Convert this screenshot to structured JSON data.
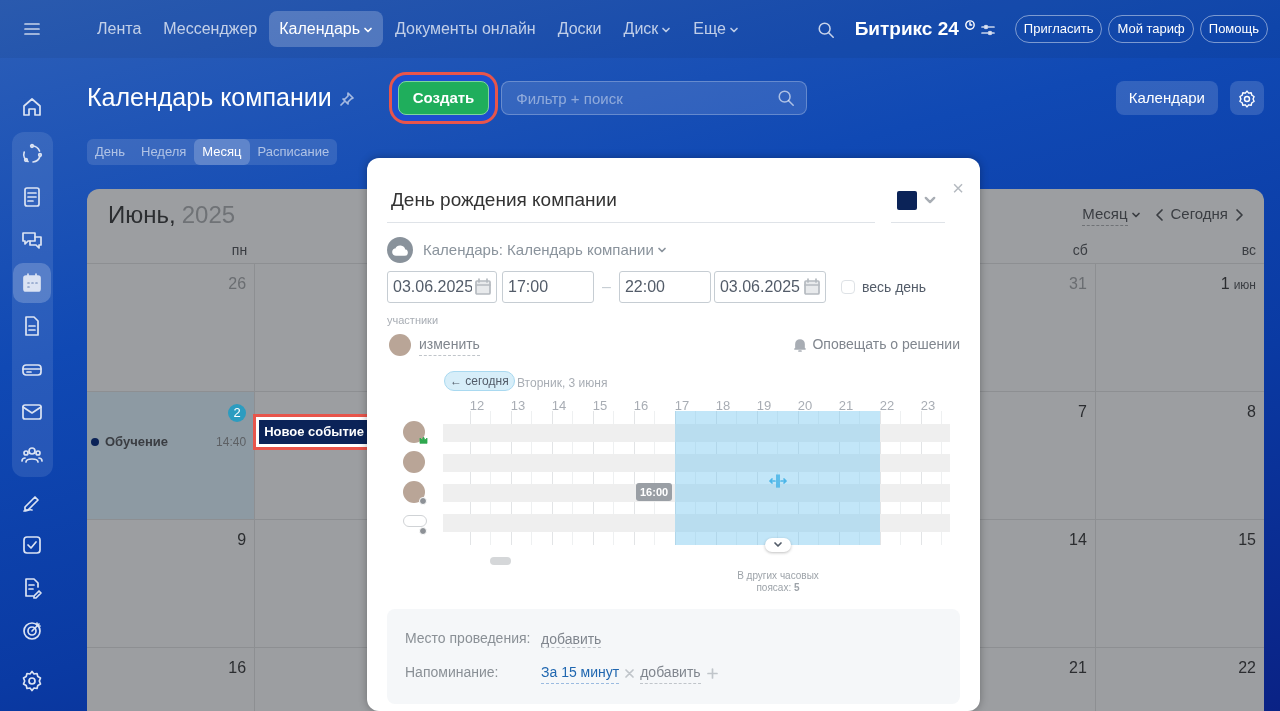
{
  "nav": {
    "items": [
      {
        "label": "Лента",
        "selected": false,
        "dropdown": false
      },
      {
        "label": "Мессенджер",
        "selected": false,
        "dropdown": false
      },
      {
        "label": "Календарь",
        "selected": true,
        "dropdown": true
      },
      {
        "label": "Документы онлайн",
        "selected": false,
        "dropdown": false
      },
      {
        "label": "Доски",
        "selected": false,
        "dropdown": false
      },
      {
        "label": "Диск",
        "selected": false,
        "dropdown": true
      },
      {
        "label": "Еще",
        "selected": false,
        "dropdown": true
      }
    ],
    "logo": "Битрикс 24",
    "buttons": [
      "Пригласить",
      "Мой тариф",
      "Помощь"
    ]
  },
  "sidebar": {
    "groups": [
      {
        "boxed": false,
        "items": [
          {
            "kind": "home",
            "selected": false
          }
        ]
      },
      {
        "boxed": true,
        "items": [
          {
            "kind": "chart",
            "selected": false
          },
          {
            "kind": "feed",
            "selected": false
          },
          {
            "kind": "chat",
            "selected": false
          },
          {
            "kind": "calendar",
            "selected": true
          },
          {
            "kind": "doc",
            "selected": false
          },
          {
            "kind": "drive",
            "selected": false
          },
          {
            "kind": "mail",
            "selected": false
          },
          {
            "kind": "people",
            "selected": false
          }
        ]
      },
      {
        "boxed": false,
        "items": [
          {
            "kind": "pencil",
            "selected": false
          },
          {
            "kind": "check",
            "selected": false
          },
          {
            "kind": "doc-edit",
            "selected": false
          },
          {
            "kind": "target",
            "selected": false
          }
        ]
      }
    ],
    "settings": {
      "kind": "gear",
      "selected": false
    }
  },
  "header": {
    "title": "Календарь компании",
    "create_button": {
      "label": "Создать",
      "highlighted": true
    },
    "search": {
      "placeholder": "Фильтр + поиск"
    },
    "calendars_button": "Календари"
  },
  "view_tabs": [
    {
      "label": "День",
      "selected": false
    },
    {
      "label": "Неделя",
      "selected": false
    },
    {
      "label": "Месяц",
      "selected": true
    },
    {
      "label": "Расписание",
      "selected": false
    }
  ],
  "calendar": {
    "month": "Июнь,",
    "year": "2025",
    "view": "Месяц",
    "today_button": "Сегодня",
    "weekdays": {
      "mon": "пн",
      "sat": "сб",
      "sun": "вс"
    },
    "weeks": [
      {
        "mon": {
          "day": "26",
          "other_month": true,
          "today": false
        },
        "sat": {
          "day": "31",
          "other_month": true,
          "today": false
        },
        "sun": {
          "day": "1",
          "month": "июн",
          "other_month": false,
          "today": false
        }
      },
      {
        "mon": {
          "day": "2",
          "other_month": false,
          "today": true,
          "events": [
            {
              "title": "Обучение",
              "time": "14:40",
              "color": "#0b2358"
            }
          ]
        },
        "tue": {
          "events": [
            {
              "title": "Новое событие",
              "kind": "draft",
              "highlighted": true
            }
          ]
        },
        "sat": {
          "day": "7",
          "other_month": false,
          "today": false
        },
        "sun": {
          "day": "8",
          "other_month": false,
          "today": false
        }
      },
      {
        "mon": {
          "day": "9",
          "other_month": false,
          "today": false
        },
        "sat": {
          "day": "14",
          "other_month": false,
          "today": false
        },
        "sun": {
          "day": "15",
          "other_month": false,
          "today": false
        }
      },
      {
        "mon": {
          "day": "16",
          "other_month": false,
          "today": false
        },
        "sat": {
          "day": "21",
          "other_month": false,
          "today": false
        },
        "sun": {
          "day": "22",
          "other_month": false,
          "today": false
        }
      }
    ]
  },
  "event_popup": {
    "title": "День рождения компании",
    "close": "×",
    "color": "#0b2358",
    "calendar": "Календарь: Календарь компании",
    "date_from": "03.06.2025",
    "time_from": "17:00",
    "separator": "–",
    "time_to": "22:00",
    "date_to": "03.06.2025",
    "all_day": {
      "label": "весь день",
      "checked": false
    },
    "participants_label": "участники",
    "change_link": "изменить",
    "notify": "Оповещать о решении",
    "planner": {
      "today_button": "← сегодня",
      "date": "Вторник, 3 июня",
      "hours": [
        {
          "label": "12",
          "selected": false
        },
        {
          "label": "13",
          "selected": false
        },
        {
          "label": "14",
          "selected": false
        },
        {
          "label": "15",
          "selected": false
        },
        {
          "label": "16",
          "selected": false
        },
        {
          "label": "17",
          "selected": true
        },
        {
          "label": "18",
          "selected": true
        },
        {
          "label": "19",
          "selected": true
        },
        {
          "label": "20",
          "selected": true
        },
        {
          "label": "21",
          "selected": true
        },
        {
          "label": "22",
          "selected": false
        },
        {
          "label": "23",
          "selected": false
        }
      ],
      "participants": [
        {
          "kind": "person",
          "host": true,
          "away": false
        },
        {
          "kind": "person",
          "host": false,
          "away": false
        },
        {
          "kind": "person",
          "host": false,
          "away": true
        },
        {
          "kind": "more",
          "host": false,
          "away": true
        }
      ],
      "hover_time": "16:00",
      "other_timezones": "В других часовых поясах: **5**"
    },
    "location": {
      "label": "Место проведения:",
      "link": "добавить"
    },
    "reminder": {
      "label": "Напоминание:",
      "value": "За 15 минут",
      "link": "добавить"
    }
  }
}
